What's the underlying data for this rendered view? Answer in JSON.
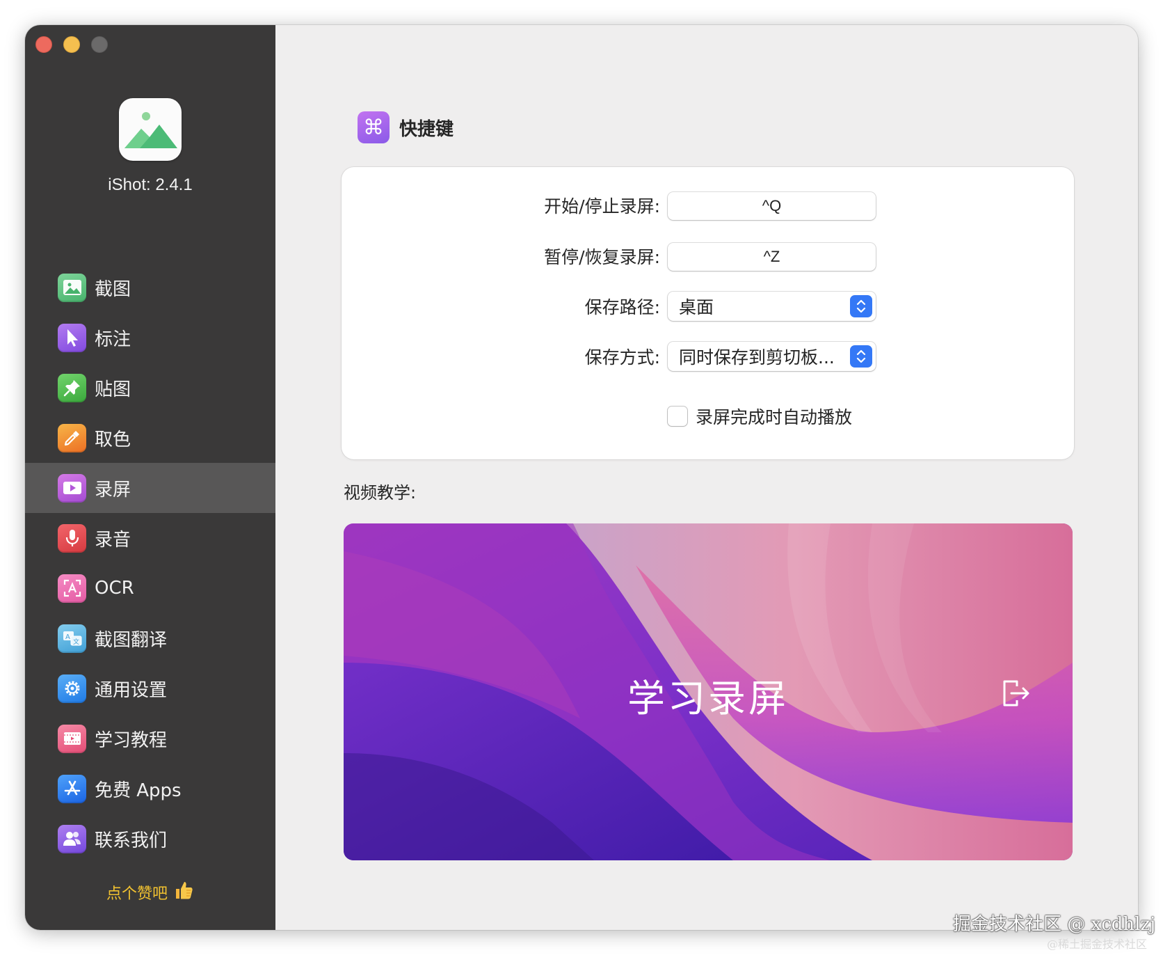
{
  "app": {
    "version_label": "iShot: 2.4.1"
  },
  "sidebar": {
    "items": [
      {
        "label": "截图",
        "icon": "image-icon",
        "color": "#5bc37d"
      },
      {
        "label": "标注",
        "icon": "cursor-icon",
        "color": "#9a5de5"
      },
      {
        "label": "贴图",
        "icon": "pin-icon",
        "color": "#4fbf4f"
      },
      {
        "label": "取色",
        "icon": "eyedropper-icon",
        "color": "#f08a2c"
      },
      {
        "label": "录屏",
        "icon": "video-camera-icon",
        "color": "#b95ad8",
        "active": true
      },
      {
        "label": "录音",
        "icon": "microphone-icon",
        "color": "#e5484d"
      },
      {
        "label": "OCR",
        "icon": "ocr-scan-icon",
        "color": "#ee6fb0"
      },
      {
        "label": "截图翻译",
        "icon": "translate-icon",
        "color": "#52b4e0"
      },
      {
        "label": "通用设置",
        "icon": "gear-icon",
        "color": "#2e8ff0"
      },
      {
        "label": "学习教程",
        "icon": "film-icon",
        "color": "#ee5f86"
      },
      {
        "label": "免费 Apps",
        "icon": "app-store-icon",
        "color": "#2f7df2"
      },
      {
        "label": "联系我们",
        "icon": "people-icon",
        "color": "#8f5fe6"
      }
    ],
    "like_label": "点个赞吧"
  },
  "content": {
    "section_title": "快捷键",
    "rows": {
      "start_stop": {
        "label": "开始/停止录屏:",
        "value": "^Q"
      },
      "pause_resume": {
        "label": "暂停/恢复录屏:",
        "value": "^Z"
      },
      "save_path": {
        "label": "保存路径:",
        "value": "桌面"
      },
      "save_mode": {
        "label": "保存方式:",
        "value": "同时保存到剪切板..."
      }
    },
    "autoplay": {
      "label": "录屏完成时自动播放",
      "checked": false
    },
    "video_section_label": "视频教学:",
    "video_title": "学习录屏"
  },
  "watermark": {
    "main": "掘金技术社区 @ xcdhlzj",
    "sub": "@稀土掘金技术社区"
  }
}
